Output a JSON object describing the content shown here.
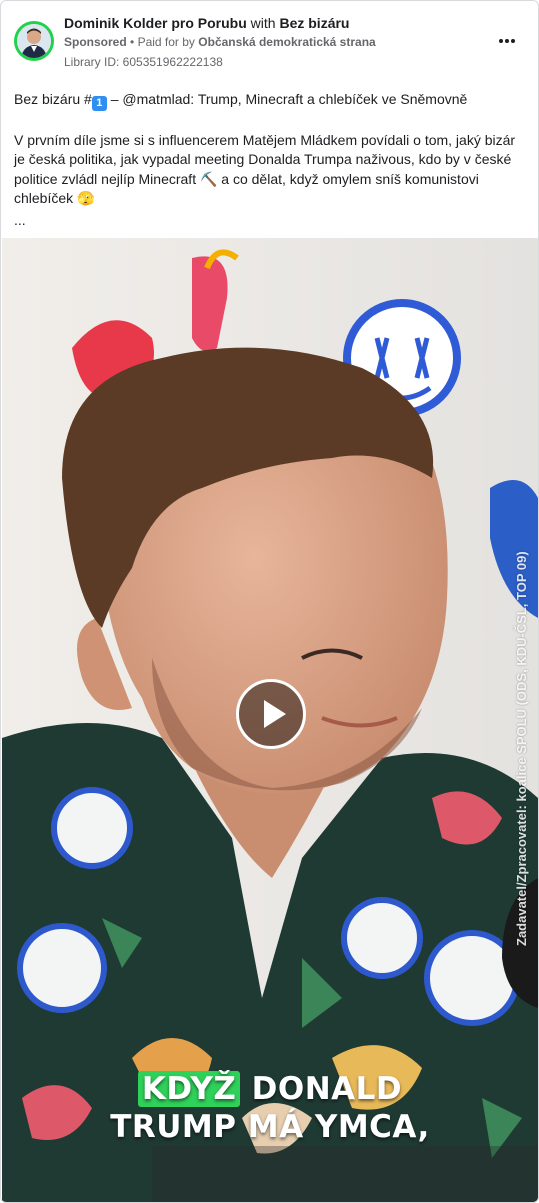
{
  "header": {
    "page_name": "Dominik Kolder pro Porubu",
    "with_word": "with",
    "partner_name": "Bez bizáru",
    "sponsored": "Sponsored",
    "paid_for_by": "Paid for by",
    "payer": "Občanská demokratická strana",
    "library_id": "Library ID: 605351962222138"
  },
  "post": {
    "title_before": "Bez bizáru #",
    "title_emoji": "1",
    "title_after": " – @matmlad: Trump, Minecraft a chlebíček ve Sněmovně",
    "body": "V prvním díle jsme si s influencerem Matějem Mládkem povídali o tom, jaký bizár je česká politika, jak vypadal meeting Donalda Trumpa naživous, kdo by v české politice zvládl nejlíp Minecraft ⛏️ a co dělat, když omylem sníš komunistovi chlebíček 🫣",
    "ellipsis": "..."
  },
  "video": {
    "caption_highlight": "KDYŽ",
    "caption_line1_rest": "DONALD",
    "caption_line2": "TRUMP MÁ YMCA,",
    "vertical_text": "Zadavatel/Zpracovatel: koalice SPOLU (ODS, KDU-ČSL, TOP 09)"
  },
  "icons": {
    "more": "more-options-icon",
    "play": "play-icon"
  },
  "colors": {
    "avatar_ring": "#1fd14b",
    "caption_highlight": "#2fd15a",
    "meta_text": "#65676b"
  }
}
